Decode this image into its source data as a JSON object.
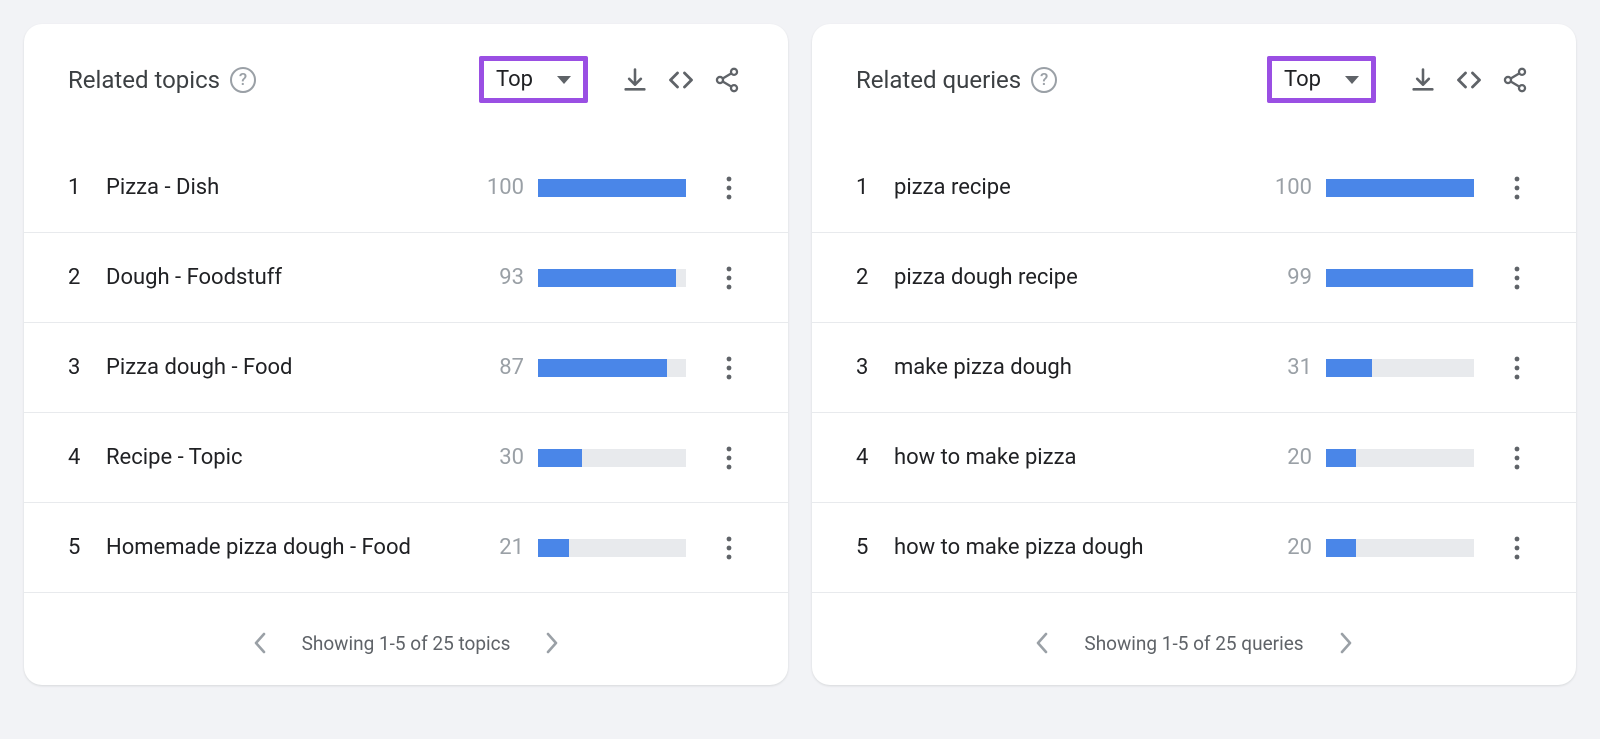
{
  "cards": [
    {
      "title": "Related topics",
      "sort_label": "Top",
      "rows": [
        {
          "rank": "1",
          "label": "Pizza - Dish",
          "value": "100",
          "pct": 100
        },
        {
          "rank": "2",
          "label": "Dough - Foodstuff",
          "value": "93",
          "pct": 93
        },
        {
          "rank": "3",
          "label": "Pizza dough - Food",
          "value": "87",
          "pct": 87
        },
        {
          "rank": "4",
          "label": "Recipe - Topic",
          "value": "30",
          "pct": 30
        },
        {
          "rank": "5",
          "label": "Homemade pizza dough - Food",
          "value": "21",
          "pct": 21
        }
      ],
      "pager_text": "Showing 1-5 of 25 topics"
    },
    {
      "title": "Related queries",
      "sort_label": "Top",
      "rows": [
        {
          "rank": "1",
          "label": "pizza recipe",
          "value": "100",
          "pct": 100
        },
        {
          "rank": "2",
          "label": "pizza dough recipe",
          "value": "99",
          "pct": 99
        },
        {
          "rank": "3",
          "label": "make pizza dough",
          "value": "31",
          "pct": 31
        },
        {
          "rank": "4",
          "label": "how to make pizza",
          "value": "20",
          "pct": 20
        },
        {
          "rank": "5",
          "label": "how to make pizza dough",
          "value": "20",
          "pct": 20
        }
      ],
      "pager_text": "Showing 1-5 of 25 queries"
    }
  ],
  "chart_data": [
    {
      "type": "bar",
      "title": "Related topics — Top",
      "categories": [
        "Pizza - Dish",
        "Dough - Foodstuff",
        "Pizza dough - Food",
        "Recipe - Topic",
        "Homemade pizza dough - Food"
      ],
      "values": [
        100,
        93,
        87,
        30,
        21
      ],
      "xlabel": "",
      "ylabel": "",
      "ylim": [
        0,
        100
      ]
    },
    {
      "type": "bar",
      "title": "Related queries — Top",
      "categories": [
        "pizza recipe",
        "pizza dough recipe",
        "make pizza dough",
        "how to make pizza",
        "how to make pizza dough"
      ],
      "values": [
        100,
        99,
        31,
        20,
        20
      ],
      "xlabel": "",
      "ylabel": "",
      "ylim": [
        0,
        100
      ]
    }
  ]
}
